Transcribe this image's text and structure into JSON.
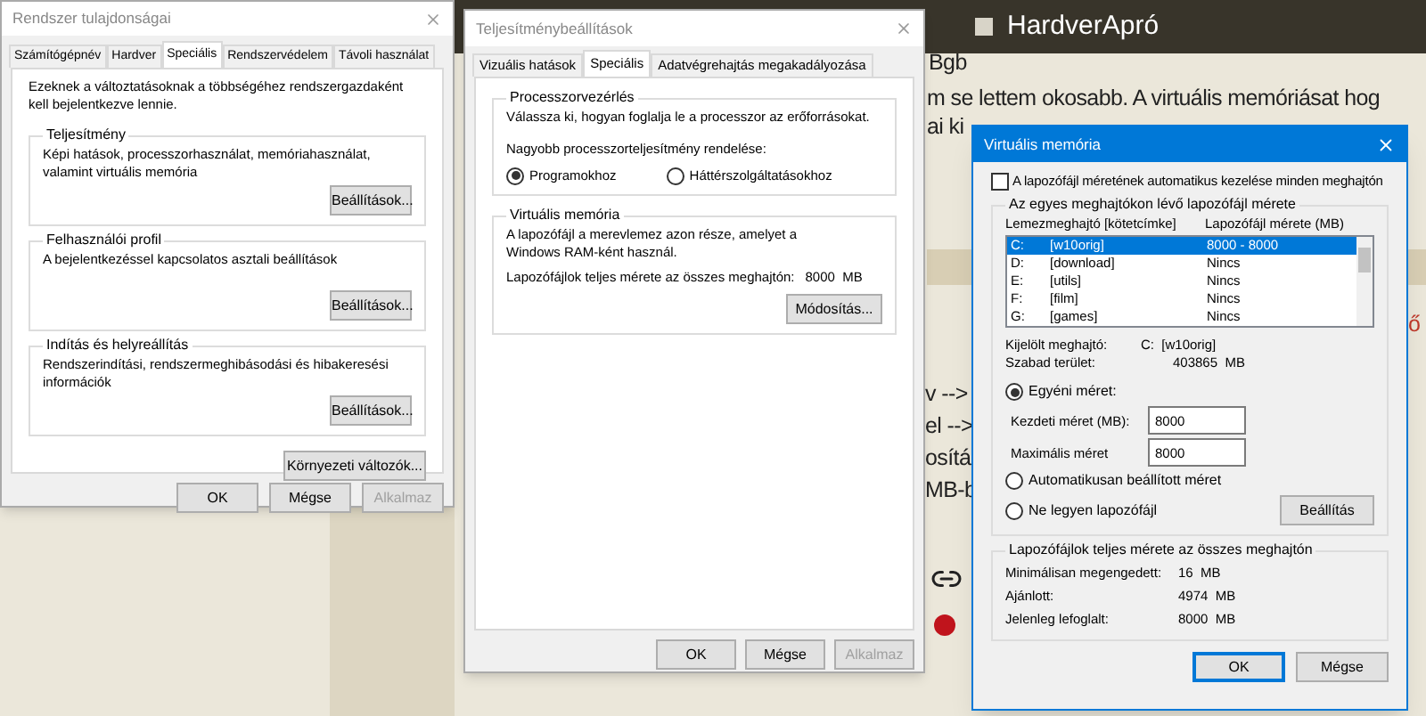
{
  "background": {
    "site_title": "HardverApró",
    "fragments": [
      {
        "text": "Bgb",
        "kind": "plain"
      },
      {
        "text": "m se lettem okosabb. A virtuális memóriásat hog",
        "kind": "plain"
      },
      {
        "text": "ai ki",
        "kind": "plain"
      },
      {
        "text": "ő",
        "kind": "red"
      },
      {
        "text": "v -->",
        "kind": "plain"
      },
      {
        "text": "el -->",
        "kind": "plain"
      },
      {
        "text": "osítá",
        "kind": "plain"
      },
      {
        "text": "MB-b",
        "kind": "plain"
      }
    ]
  },
  "system_properties": {
    "title": "Rendszer tulajdonságai",
    "tabs": [
      {
        "label": "Számítógépnév",
        "selected": false
      },
      {
        "label": "Hardver",
        "selected": false
      },
      {
        "label": "Speciális",
        "selected": true
      },
      {
        "label": "Rendszervédelem",
        "selected": false
      },
      {
        "label": "Távoli használat",
        "selected": false
      }
    ],
    "intro": "Ezeknek a változtatásoknak a többségéhez rendszergazdaként kell bejelentkezve lennie.",
    "groups": [
      {
        "title": "Teljesítmény",
        "text": "Képi hatások, processzorhasználat, memóriahasználat, valamint virtuális memória",
        "button": "Beállítások..."
      },
      {
        "title": "Felhasználói profil",
        "text": "A bejelentkezéssel kapcsolatos asztali beállítások",
        "button": "Beállítások..."
      },
      {
        "title": "Indítás és helyreállítás",
        "text": "Rendszerindítási, rendszermeghibásodási és hibakeresési információk",
        "button": "Beállítások..."
      }
    ],
    "env_button": "Környezeti változók...",
    "buttons": [
      {
        "label": "OK",
        "disabled": false
      },
      {
        "label": "Mégse",
        "disabled": false
      },
      {
        "label": "Alkalmaz",
        "disabled": true
      }
    ]
  },
  "performance_options": {
    "title": "Teljesítménybeállítások",
    "tabs": [
      {
        "label": "Vizuális hatások",
        "selected": false
      },
      {
        "label": "Speciális",
        "selected": true
      },
      {
        "label": "Adatvégrehajtás megakadályozása",
        "selected": false
      }
    ],
    "processor": {
      "title": "Processzorvezérlés",
      "text": "Válassza ki, hogyan foglalja le a processzor az erőforrásokat.",
      "label": "Nagyobb processzorteljesítmény rendelése:",
      "options": [
        {
          "label": "Programokhoz",
          "selected": true
        },
        {
          "label": "Háttérszolgáltatásokhoz",
          "selected": false
        }
      ]
    },
    "virtual_memory": {
      "title": "Virtuális memória",
      "text": "A lapozófájl a merevlemez azon része, amelyet a Windows RAM-ként használ.",
      "total_label": "Lapozófájlok teljes mérete az összes meghajtón:",
      "total_value": "8000  MB",
      "button": "Módosítás..."
    },
    "buttons": [
      {
        "label": "OK",
        "disabled": false
      },
      {
        "label": "Mégse",
        "disabled": false
      },
      {
        "label": "Alkalmaz",
        "disabled": true
      }
    ]
  },
  "virtual_memory": {
    "title": "Virtuális memória",
    "auto_manage": {
      "label": "A lapozófájl méretének automatikus kezelése minden meghajtón",
      "checked": false
    },
    "drives_group": {
      "title": "Az egyes meghajtókon lévő lapozófájl mérete",
      "columns": [
        "Lemezmeghajtó [kötetcímke]",
        "Lapozófájl mérete (MB)"
      ],
      "rows": [
        {
          "drive": "C:",
          "label": "[w10orig]",
          "size": "8000 - 8000",
          "selected": true
        },
        {
          "drive": "D:",
          "label": "[download]",
          "size": "Nincs",
          "selected": false
        },
        {
          "drive": "E:",
          "label": "[utils]",
          "size": "Nincs",
          "selected": false
        },
        {
          "drive": "F:",
          "label": "[film]",
          "size": "Nincs",
          "selected": false
        },
        {
          "drive": "G:",
          "label": "[games]",
          "size": "Nincs",
          "selected": false
        }
      ],
      "selected_drive_label": "Kijelölt meghajtó:",
      "selected_drive_value": "C:  [w10orig]",
      "free_label": "Szabad terület:",
      "free_value": "403865  MB",
      "options": [
        {
          "kind": "custom",
          "label": "Egyéni méret:",
          "selected": true
        },
        {
          "kind": "auto",
          "label": "Automatikusan beállított méret",
          "selected": false
        },
        {
          "kind": "none",
          "label": "Ne legyen lapozófájl",
          "selected": false
        }
      ],
      "fields": [
        {
          "label": "Kezdeti méret (MB):",
          "value": "8000"
        },
        {
          "label": "Maximális méret",
          "value": "8000"
        }
      ],
      "set_button": "Beállítás"
    },
    "totals_group": {
      "title": "Lapozófájlok teljes mérete az összes meghajtón",
      "rows": [
        {
          "label": "Minimálisan megengedett:",
          "value": "16  MB"
        },
        {
          "label": "Ajánlott:",
          "value": "4974  MB"
        },
        {
          "label": "Jelenleg lefoglalt:",
          "value": "8000  MB"
        }
      ]
    },
    "buttons": [
      {
        "label": "OK",
        "focused": true
      },
      {
        "label": "Mégse",
        "focused": false
      }
    ]
  }
}
